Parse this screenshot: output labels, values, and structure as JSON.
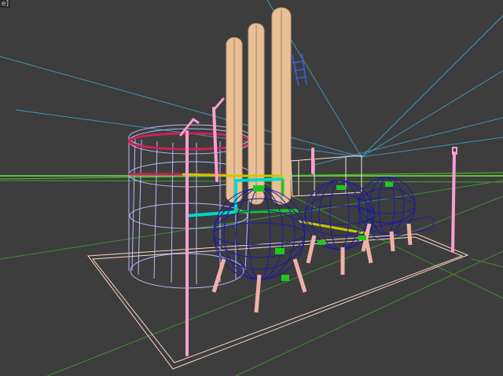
{
  "viewport": {
    "label": "e]",
    "background": "#3d3d3d"
  },
  "scene": {
    "colors": {
      "ground_grid": "#5dbf3c",
      "grid_lines": "#3f8f30",
      "sun_rays": "#3fa0c8",
      "base_plate": "#ffd7c8",
      "tank": "#b9b9ff",
      "tank_ring": "#cc2255",
      "chimney": "#e9bf95",
      "sphere": "#1a1aa8",
      "sphere_legs": "#f0b0a8",
      "lamp_post": "#ff9ecf",
      "pipe": "#00d8c8",
      "pipe_yellow": "#c8c800",
      "ladder": "#3a5fe0",
      "green_parts": "#1ec81e"
    }
  }
}
